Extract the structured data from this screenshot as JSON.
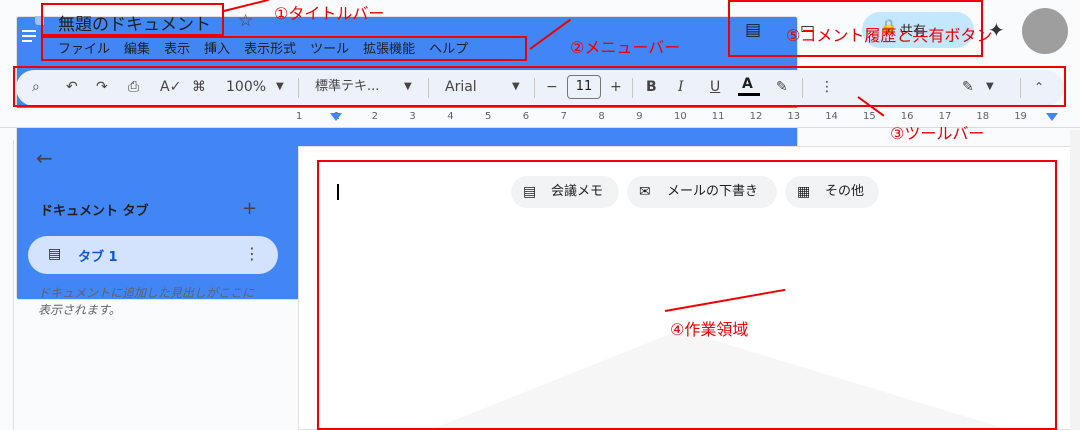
{
  "header": {
    "title": "無題のドキュメント",
    "star_icon": "☆",
    "share_label": "共有",
    "sparkle_icon": "✦"
  },
  "menubar": {
    "items": [
      "ファイル",
      "編集",
      "表示",
      "挿入",
      "表示形式",
      "ツール",
      "拡張機能",
      "ヘルプ"
    ]
  },
  "toolbar": {
    "zoom": "100%",
    "style": "標準テキ...",
    "font": "Arial",
    "font_size": "11",
    "bold": "B",
    "italic": "I",
    "underline": "U",
    "text_color": "A"
  },
  "ruler": {
    "numbers": [
      "1",
      "1",
      "2",
      "3",
      "4",
      "5",
      "6",
      "7",
      "8",
      "9",
      "10",
      "11",
      "12",
      "13",
      "14",
      "15",
      "16",
      "17",
      "18",
      "19"
    ]
  },
  "sidebar": {
    "heading": "ドキュメント タブ",
    "tab_label": "タブ 1",
    "hint": "ドキュメントに追加した見出しがここに表示されます。"
  },
  "page": {
    "chips": [
      {
        "label": "会議メモ",
        "icon": "doc-icon"
      },
      {
        "label": "メールの下書き",
        "icon": "mail-icon"
      },
      {
        "label": "その他",
        "icon": "add-doc-icon"
      }
    ]
  },
  "annotations": {
    "title_bar": "①タイトルバー",
    "menu_bar": "②メニューバー",
    "toolbar": "③ツールバー",
    "work_area": "④作業領域",
    "comment_share": "⑤コメント履歴と共有ボタン"
  },
  "colors": {
    "annotation": "#ee0000",
    "share_button": "#c2e7ff",
    "toolbar_bg": "#edf2fa",
    "tab_active": "#d3e3fd"
  }
}
